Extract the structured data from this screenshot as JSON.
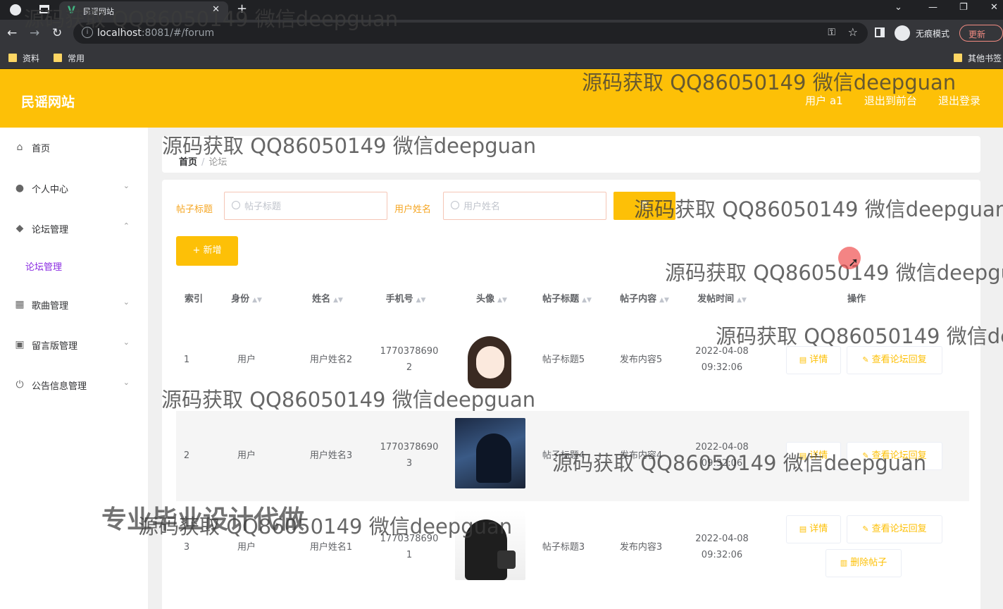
{
  "browser": {
    "tab_title": "民谣网站",
    "url_host": "localhost",
    "url_rest": ":8081/#/forum",
    "incognito_label": "无痕模式",
    "update_label": "更新",
    "bookmarks": [
      "资料",
      "常用"
    ],
    "other_bookmarks": "其他书签"
  },
  "header": {
    "title": "民谣网站",
    "user": "用户 a1",
    "back_front": "退出到前台",
    "logout": "退出登录"
  },
  "sidebar": {
    "items": [
      {
        "label": "首页",
        "icon": "home-icon"
      },
      {
        "label": "个人中心",
        "icon": "user-icon"
      },
      {
        "label": "论坛管理",
        "icon": "bulb-icon"
      },
      {
        "label": "歌曲管理",
        "icon": "grid-icon"
      },
      {
        "label": "留言版管理",
        "icon": "clipboard-icon"
      },
      {
        "label": "公告信息管理",
        "icon": "power-icon"
      }
    ],
    "sub_item": "论坛管理"
  },
  "breadcrumb": {
    "home": "首页",
    "current": "论坛"
  },
  "filters": {
    "title_label": "帖子标题",
    "title_placeholder": "帖子标题",
    "name_label": "用户姓名",
    "name_placeholder": "用户姓名",
    "search_label": "查"
  },
  "add_button": "+ 新增",
  "table": {
    "headers": [
      "索引",
      "身份",
      "姓名",
      "手机号",
      "头像",
      "帖子标题",
      "帖子内容",
      "发帖时间",
      "操作"
    ],
    "rows": [
      {
        "index": "1",
        "role": "用户",
        "name": "用户姓名2",
        "phone_a": "1770378690",
        "phone_b": "2",
        "title": "帖子标题5",
        "content": "发布内容5",
        "date": "2022-04-08",
        "time": "09:32:06"
      },
      {
        "index": "2",
        "role": "用户",
        "name": "用户姓名3",
        "phone_a": "1770378690",
        "phone_b": "3",
        "title": "帖子标题4",
        "content": "发布内容4",
        "date": "2022-04-08",
        "time": "09:32:06"
      },
      {
        "index": "3",
        "role": "用户",
        "name": "用户姓名1",
        "phone_a": "1770378690",
        "phone_b": "1",
        "title": "帖子标题3",
        "content": "发布内容3",
        "date": "2022-04-08",
        "time": "09:32:06"
      }
    ],
    "detail_label": "详情",
    "reply_label": "查看论坛回复",
    "delete_label": "删除帖子"
  },
  "watermarks": {
    "main": "源码获取 QQ86050149 微信deepguan",
    "promo": "专业毕业设计代做"
  }
}
